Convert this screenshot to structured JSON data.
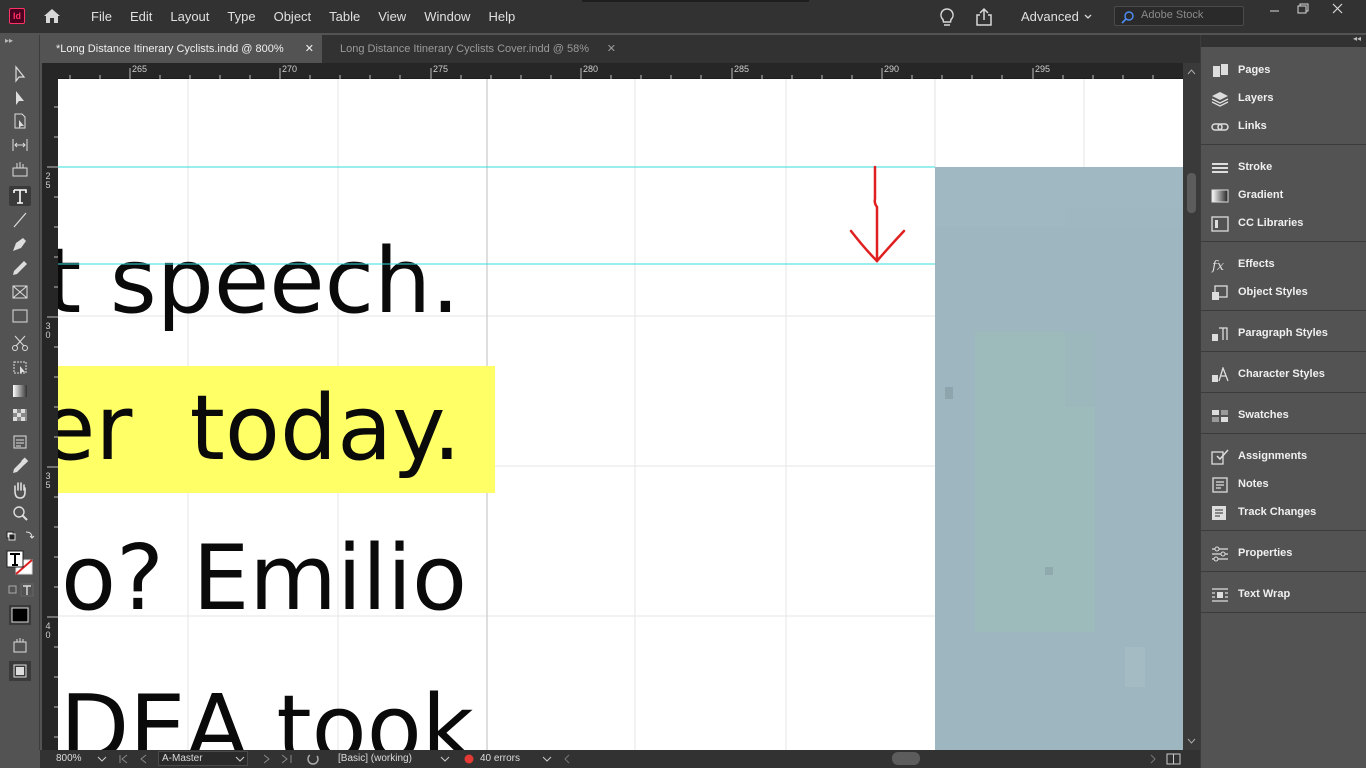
{
  "app": {
    "logo_text": "Id",
    "menu": [
      "File",
      "Edit",
      "Layout",
      "Type",
      "Object",
      "Table",
      "View",
      "Window",
      "Help"
    ],
    "workspace": "Advanced",
    "search_placeholder": "Adobe Stock"
  },
  "tabs": [
    {
      "label": "*Long Distance Itinerary Cyclists.indd @ 800%",
      "active": true
    },
    {
      "label": "Long Distance Itinerary Cyclists Cover.indd @ 58%",
      "active": false
    }
  ],
  "ruler": {
    "horizontal": [
      "265",
      "270",
      "275",
      "280",
      "285",
      "290",
      "295"
    ],
    "vertical": [
      [
        "2",
        "5"
      ],
      [
        "3",
        "0"
      ],
      [
        "3",
        "5"
      ],
      [
        "4",
        "0"
      ]
    ]
  },
  "document": {
    "lines": [
      "t speech.",
      "er  today.",
      "io? Emilio",
      "DEA took"
    ],
    "highlight_color": "#ffff66",
    "guide_color": "#33dddd",
    "annotation_color": "#e02020"
  },
  "status": {
    "zoom": "800%",
    "master": "A-Master",
    "profile": "[Basic] (working)",
    "errors": "40 errors"
  },
  "panels": [
    {
      "label": "Pages",
      "icon": "pages-icon"
    },
    {
      "label": "Layers",
      "icon": "layers-icon"
    },
    {
      "label": "Links",
      "icon": "links-icon"
    },
    {
      "label": "Stroke",
      "icon": "stroke-icon"
    },
    {
      "label": "Gradient",
      "icon": "gradient-icon"
    },
    {
      "label": "CC Libraries",
      "icon": "cc-libraries-icon"
    },
    {
      "label": "Effects",
      "icon": "effects-icon"
    },
    {
      "label": "Object Styles",
      "icon": "object-styles-icon"
    },
    {
      "label": "Paragraph Styles",
      "icon": "paragraph-styles-icon"
    },
    {
      "label": "Character Styles",
      "icon": "character-styles-icon"
    },
    {
      "label": "Swatches",
      "icon": "swatches-icon"
    },
    {
      "label": "Assignments",
      "icon": "assignments-icon"
    },
    {
      "label": "Notes",
      "icon": "notes-icon"
    },
    {
      "label": "Track Changes",
      "icon": "track-changes-icon"
    },
    {
      "label": "Properties",
      "icon": "properties-icon"
    },
    {
      "label": "Text Wrap",
      "icon": "text-wrap-icon"
    }
  ]
}
